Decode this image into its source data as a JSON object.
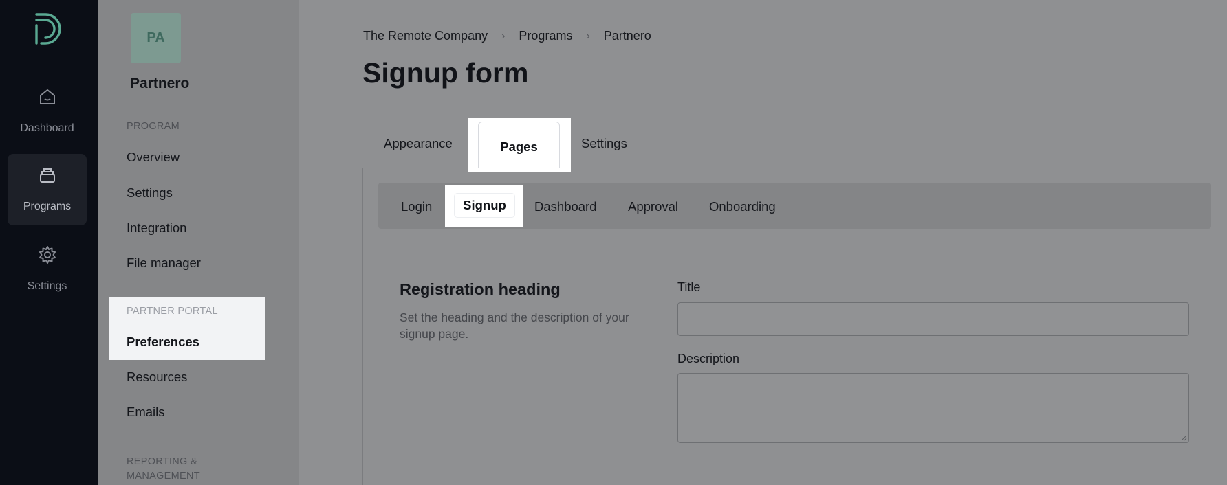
{
  "rail": {
    "items": [
      {
        "label": "Dashboard",
        "icon": "home-icon"
      },
      {
        "label": "Programs",
        "icon": "stack-icon"
      },
      {
        "label": "Settings",
        "icon": "gear-icon"
      }
    ]
  },
  "sidebar": {
    "avatar": "PA",
    "program_name": "Partnero",
    "sections": [
      {
        "title": "PROGRAM",
        "items": [
          "Overview",
          "Settings",
          "Integration",
          "File manager"
        ]
      },
      {
        "title": "PARTNER PORTAL",
        "items": [
          "Preferences",
          "Resources",
          "Emails"
        ]
      },
      {
        "title": "REPORTING &\nMANAGEMENT",
        "items": []
      }
    ]
  },
  "breadcrumb": [
    "The Remote Company",
    "Programs",
    "Partnero"
  ],
  "page_title": "Signup form",
  "tabs": [
    "Appearance",
    "Pages",
    "Settings"
  ],
  "active_tab": "Pages",
  "subtabs": [
    "Login",
    "Signup",
    "Dashboard",
    "Approval",
    "Onboarding"
  ],
  "active_subtab": "Signup",
  "form": {
    "section_heading": "Registration heading",
    "section_description": "Set the heading and the description of your signup page.",
    "title_label": "Title",
    "title_value": "",
    "description_label": "Description",
    "description_value": ""
  },
  "colors": {
    "rail_bg": "#0b0e16",
    "brand_green": "#5aa992",
    "highlight": "#ffffff"
  }
}
